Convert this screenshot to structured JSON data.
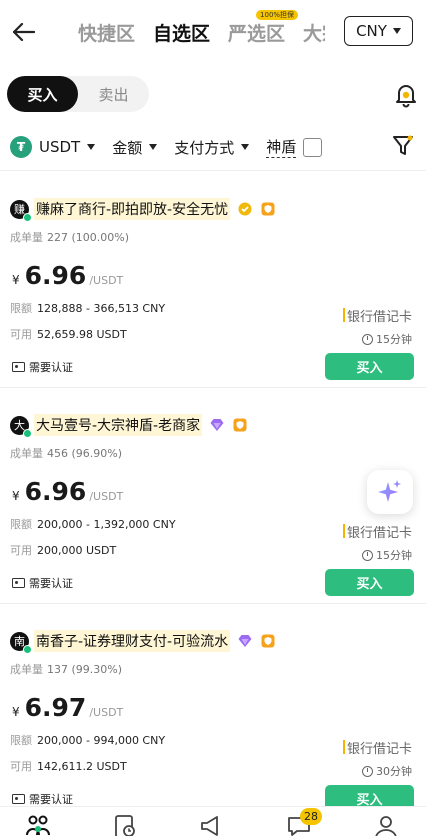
{
  "header": {
    "tabs": [
      {
        "label": "快捷区",
        "active": false
      },
      {
        "label": "自选区",
        "active": true
      },
      {
        "label": "严选区",
        "active": false,
        "badge": "100%担保"
      },
      {
        "label": "大宗",
        "active": false
      }
    ],
    "currency": "CNY"
  },
  "side_toggle": {
    "buy": "买入",
    "sell": "卖出",
    "selected": "buy"
  },
  "filters": {
    "asset": "USDT",
    "amount": "金额",
    "payment": "支付方式",
    "shield": "神盾",
    "shield_checked": false
  },
  "colors": {
    "accent": "#2dbd7e",
    "highlight": "#fff6d5",
    "badge": "#f5c400"
  },
  "ads": [
    {
      "avatar": "赚",
      "merchant": "赚麻了商行-即拍即放-安全无忧",
      "badge_icons": [
        "gold-medal-icon",
        "orange-shield-icon"
      ],
      "completion_label": "成单量",
      "completion": "227 (100.00%)",
      "currency_symbol": "¥",
      "price": "6.96",
      "unit": "/USDT",
      "limit_label": "限额",
      "limit": "128,888 - 366,513 CNY",
      "available_label": "可用",
      "available": "52,659.98 USDT",
      "verify": "需要认证",
      "payment": "银行借记卡",
      "time": "15分钟",
      "action": "买入"
    },
    {
      "avatar": "大",
      "merchant": "大马壹号-大宗神盾-老商家",
      "badge_icons": [
        "purple-diamond-icon",
        "orange-shield-icon"
      ],
      "completion_label": "成单量",
      "completion": "456 (96.90%)",
      "currency_symbol": "¥",
      "price": "6.96",
      "unit": "/USDT",
      "limit_label": "限额",
      "limit": "200,000 - 1,392,000 CNY",
      "available_label": "可用",
      "available": "200,000 USDT",
      "verify": "需要认证",
      "payment": "银行借记卡",
      "time": "15分钟",
      "action": "买入"
    },
    {
      "avatar": "南",
      "merchant": "南香子-证券理财支付-可验流水",
      "badge_icons": [
        "purple-diamond-icon",
        "orange-shield-icon"
      ],
      "completion_label": "成单量",
      "completion": "137 (99.30%)",
      "currency_symbol": "¥",
      "price": "6.97",
      "unit": "/USDT",
      "limit_label": "限额",
      "limit": "200,000 - 994,000 CNY",
      "available_label": "可用",
      "available": "142,611.2 USDT",
      "verify": "需要认证",
      "payment": "银行借记卡",
      "time": "30分钟",
      "action": "买入"
    }
  ],
  "bottom_nav": {
    "items": [
      "p2p-people-icon",
      "orders-icon",
      "announcement-icon",
      "chat-icon",
      "profile-icon"
    ],
    "chat_badge": "28"
  }
}
